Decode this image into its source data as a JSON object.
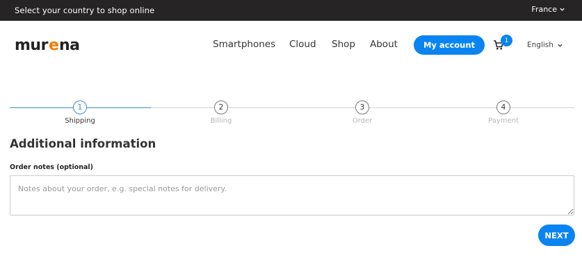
{
  "topbar": {
    "message": "Select your country to shop online",
    "country": "France"
  },
  "header": {
    "logo_text": "murena",
    "nav": [
      "Smartphones",
      "Cloud",
      "Shop",
      "About"
    ],
    "account_label": "My account",
    "cart_count": "1",
    "language": "English"
  },
  "steps": [
    {
      "number": "1",
      "label": "Shipping",
      "active": true
    },
    {
      "number": "2",
      "label": "Billing",
      "active": false
    },
    {
      "number": "3",
      "label": "Order",
      "active": false
    },
    {
      "number": "4",
      "label": "Payment",
      "active": false
    }
  ],
  "form": {
    "section_title": "Additional information",
    "notes_label": "Order notes (optional)",
    "notes_placeholder": "Notes about your order, e.g. special notes for delivery.",
    "notes_value": ""
  },
  "actions": {
    "next_label": "NEXT"
  },
  "colors": {
    "accent": "#0a84f0",
    "topbar_bg": "#262424",
    "logo_highlight": "#f57c00"
  }
}
